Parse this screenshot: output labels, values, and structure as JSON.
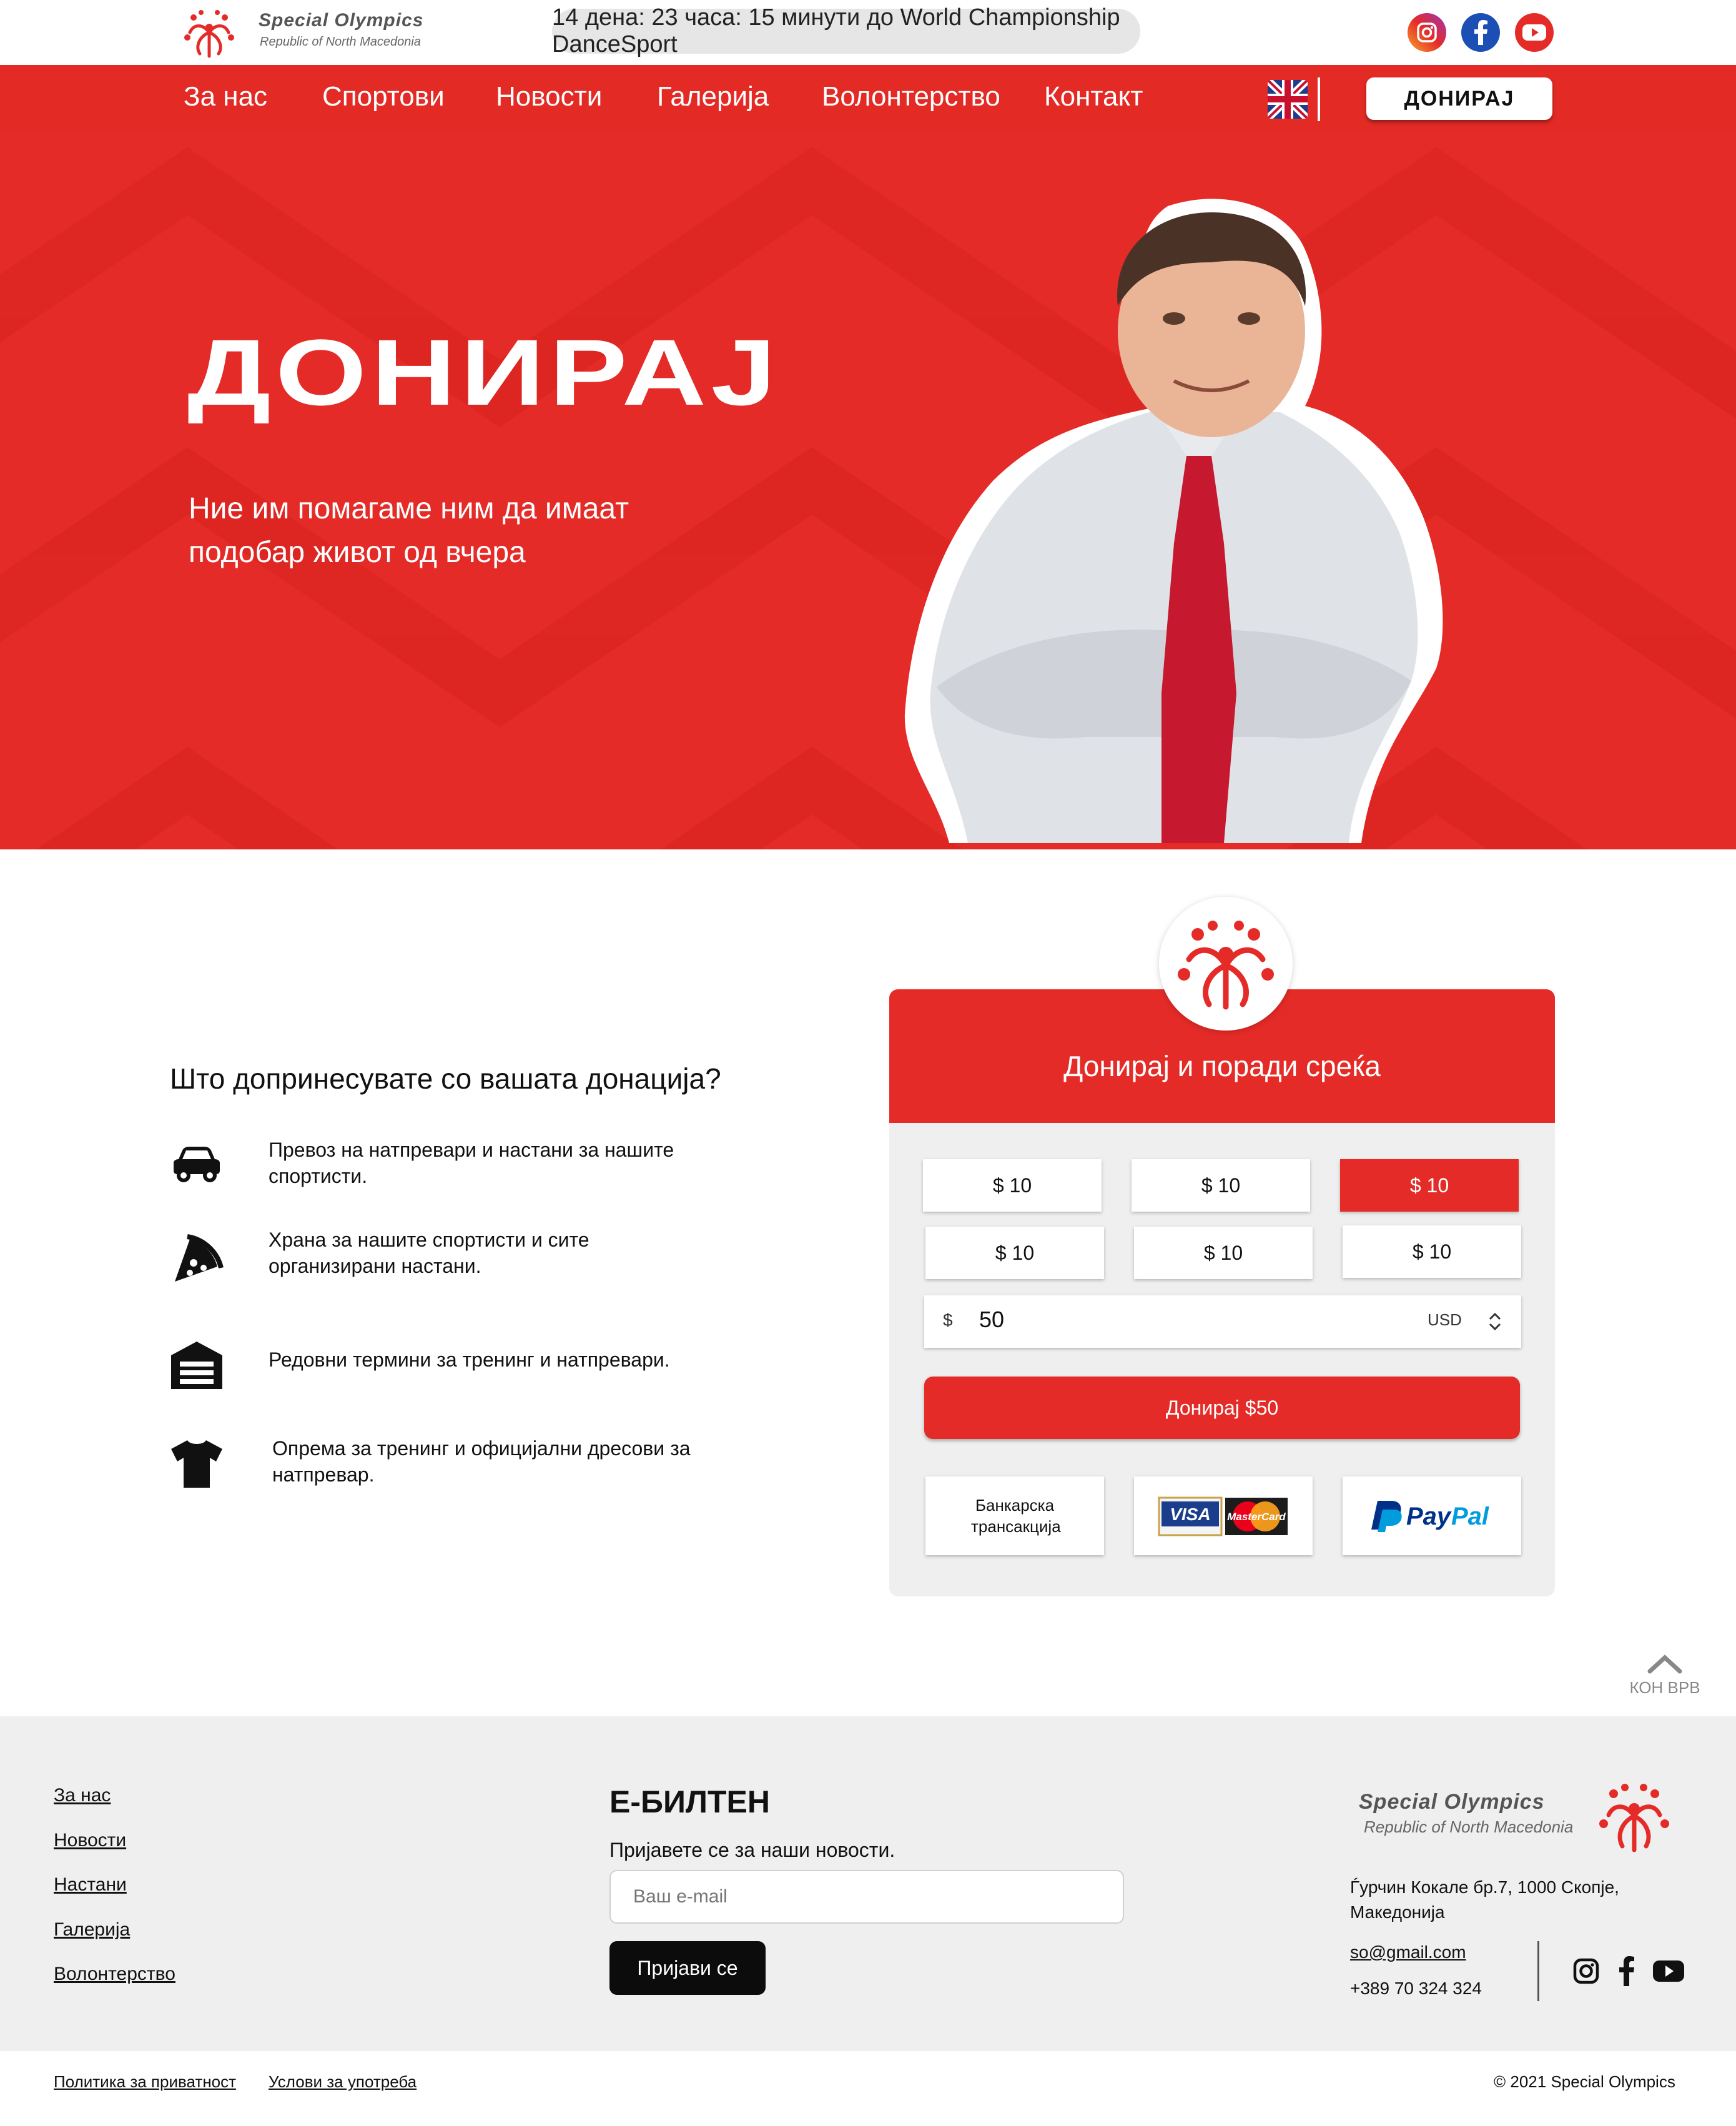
{
  "brand": {
    "name": "Special Olympics",
    "subtitle": "Republic of North Macedonia"
  },
  "topbar": {
    "countdown": "14 дена: 23 часа: 15 минути до World Championship DanceSport"
  },
  "nav": {
    "items": [
      "За нас",
      "Спортови",
      "Новости",
      "Галерија",
      "Волонтерство",
      "Контакт"
    ],
    "donate_label": "ДОНИРАЈ"
  },
  "hero": {
    "title": "ДОНИРАЈ",
    "subtitle": "Ние им помагаме ним да имаат подобар живот од вчера"
  },
  "benefits": {
    "title": "Што допринесувате со вашата донација?",
    "items": [
      {
        "icon": "car-icon",
        "text": "Превоз на натпревари и настани за нашите спортисти."
      },
      {
        "icon": "pizza-icon",
        "text": "Храна за нашите спортисти и сите организирани настани."
      },
      {
        "icon": "garage-icon",
        "text": "Редовни термини за тренинг и натпревари."
      },
      {
        "icon": "tshirt-icon",
        "text": "Опрема за тренинг и официјални дресови за натпревар."
      }
    ]
  },
  "donation": {
    "title": "Донирај и поради среќа",
    "amounts": [
      "$ 10",
      "$ 10",
      "$ 10",
      "$ 10",
      "$ 10",
      "$ 10"
    ],
    "selected_index": 2,
    "currency_symbol": "$",
    "custom_amount": "50",
    "currency": "USD",
    "submit_label": "Донирај $50",
    "payment_methods": {
      "bank": "Банкарска трансакција",
      "visa": "VISA",
      "mastercard": "MasterCard",
      "paypal_pay": "Pay",
      "paypal_pal": "Pal"
    }
  },
  "back_to_top": "КОН ВРВ",
  "footer": {
    "links": [
      "За нас",
      "Новости",
      "Настани",
      "Галерија",
      "Волонтерство"
    ],
    "newsletter_title": "Е-БИЛТЕН",
    "newsletter_sub": "Пријавете се за наши новости.",
    "email_placeholder": "Ваш e-mail",
    "subscribe_label": "Пријави се",
    "address": "Ѓурчин Кокале бр.7, 1000 Скопје, Македонија",
    "email": "so@gmail.com",
    "phone": "+389 70 324 324",
    "privacy": "Политика за приватност",
    "terms": "Услови за употреба",
    "copyright": "© 2021 Special Olympics"
  },
  "colors": {
    "brand_red": "#e52b27",
    "footer_bg": "#efefef"
  }
}
